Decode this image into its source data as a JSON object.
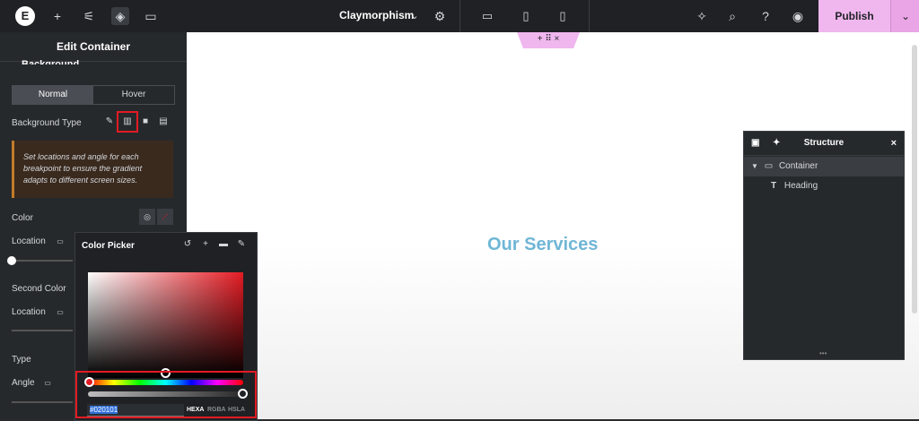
{
  "topbar": {
    "doc_title": "Claymorphism",
    "publish_label": "Publish"
  },
  "panel": {
    "title": "Edit Container",
    "section": "Background",
    "tabs": [
      "Normal",
      "Hover"
    ],
    "background_type_label": "Background Type",
    "notice": "Set locations and angle for each breakpoint to ensure the gradient adapts to different screen sizes.",
    "color_label": "Color",
    "location_label": "Location",
    "second_color_label": "Second Color",
    "second_location_label": "Location",
    "type_label": "Type",
    "angle_label": "Angle"
  },
  "canvas": {
    "heading": "Our Services"
  },
  "structure": {
    "title": "Structure",
    "items": [
      {
        "label": "Container"
      },
      {
        "label": "Heading"
      }
    ]
  },
  "color_picker": {
    "title": "Color Picker",
    "hex_value": "#020101",
    "formats": [
      "HEXA",
      "RGBA",
      "HSLA"
    ],
    "active_format": "HEXA"
  },
  "colors": {
    "accent": "#f0b6ee",
    "highlight": "#e31b23",
    "heading": "#6fb6d6"
  }
}
